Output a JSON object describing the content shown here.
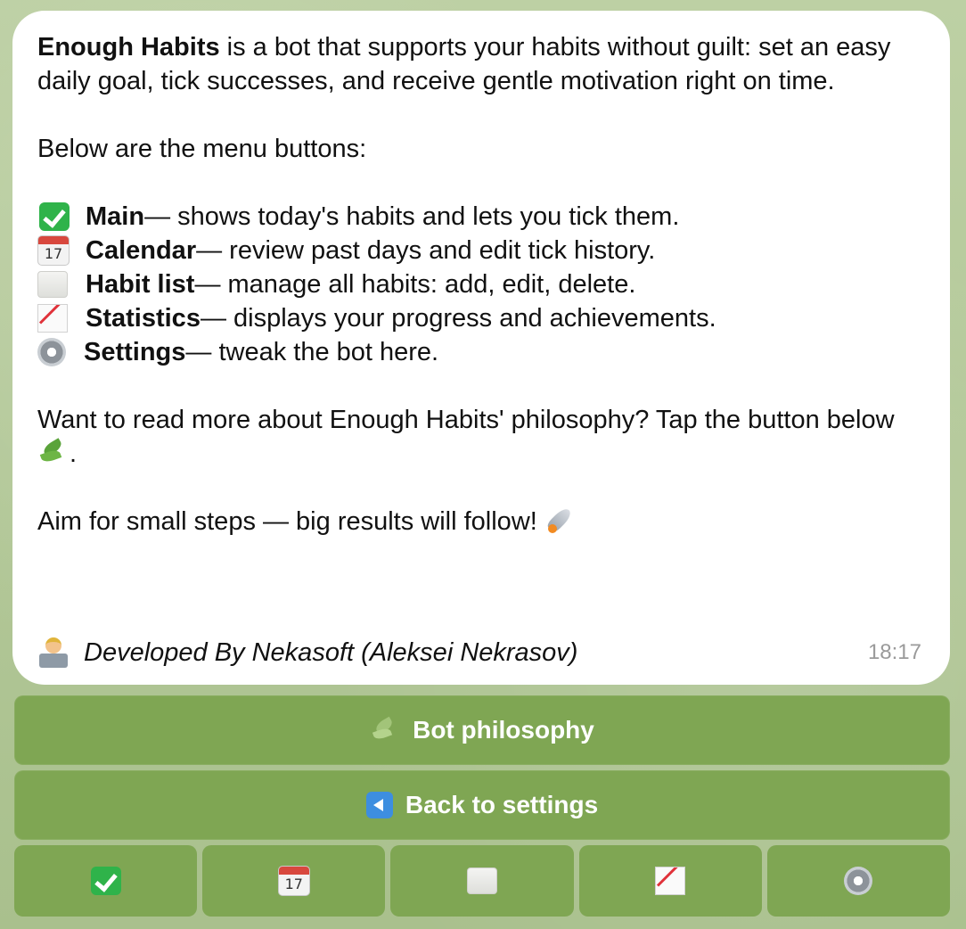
{
  "message": {
    "intro_bold": "Enough Habits",
    "intro_rest": " is a bot that supports your habits without guilt: set an easy daily goal, tick successes, and receive gentle motivation right on time.",
    "menu_heading": "Below are the menu buttons:",
    "menu_items": [
      {
        "icon": "check-icon",
        "name": "Main",
        "desc": " — shows today's habits and lets you tick them."
      },
      {
        "icon": "calendar-icon",
        "name": "Calendar",
        "desc": " — review past days and edit tick history."
      },
      {
        "icon": "scroll-icon",
        "name": "Habit list",
        "desc": " — manage all habits: add, edit, delete."
      },
      {
        "icon": "chart-icon",
        "name": "Statistics",
        "desc": " — displays your progress and achievements."
      },
      {
        "icon": "gear-icon",
        "name": "Settings",
        "desc": " — tweak the bot here."
      }
    ],
    "calendar_day": "17",
    "philosophy_text": "Want to read more about Enough Habits' philosophy? Tap the button below",
    "philosophy_end": ".",
    "aim_text": "Aim for small steps — big results will follow!",
    "developer": "Developed By Nekasoft (Aleksei Nekrasov)",
    "time": "18:17"
  },
  "keyboard": {
    "philosophy_button": "Bot philosophy",
    "back_button": "Back to settings",
    "icon_buttons": [
      "check-icon",
      "calendar-icon",
      "scroll-icon",
      "chart-icon",
      "gear-icon"
    ]
  },
  "colors": {
    "background": "#b3c89a",
    "button": "#7fa653",
    "bubble": "#ffffff",
    "time": "#9a9a9a"
  }
}
